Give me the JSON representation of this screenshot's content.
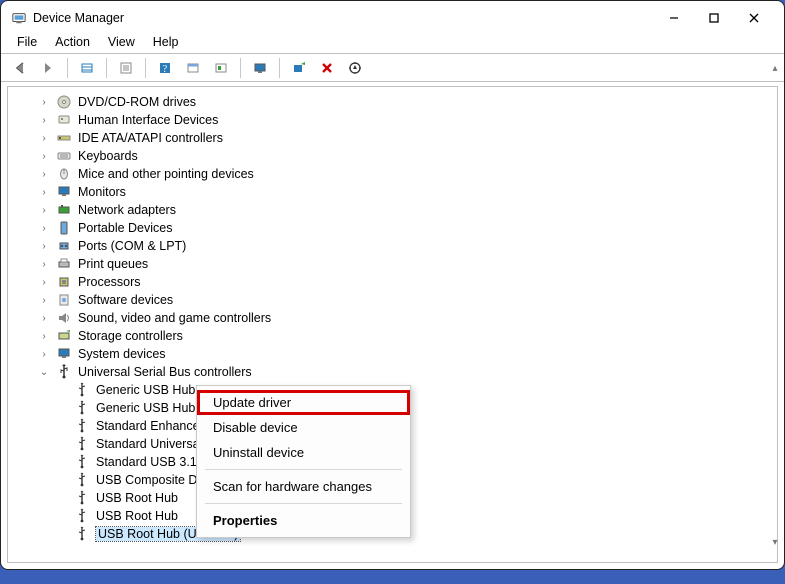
{
  "window": {
    "title": "Device Manager"
  },
  "menus": [
    "File",
    "Action",
    "View",
    "Help"
  ],
  "toolbar_icons": [
    "back-arrow-icon",
    "forward-arrow-icon",
    "divider",
    "show-hidden-icon",
    "divider",
    "properties-icon",
    "divider",
    "help-icon",
    "list-icon",
    "tree-icon",
    "divider",
    "monitor-icon",
    "divider",
    "scan-icon",
    "delete-red-x-icon",
    "target-icon"
  ],
  "tree": [
    {
      "label": "DVD/CD-ROM drives",
      "icon": "disc"
    },
    {
      "label": "Human Interface Devices",
      "icon": "hid"
    },
    {
      "label": "IDE ATA/ATAPI controllers",
      "icon": "ide"
    },
    {
      "label": "Keyboards",
      "icon": "keyboard"
    },
    {
      "label": "Mice and other pointing devices",
      "icon": "mouse"
    },
    {
      "label": "Monitors",
      "icon": "monitor"
    },
    {
      "label": "Network adapters",
      "icon": "network"
    },
    {
      "label": "Portable Devices",
      "icon": "portable"
    },
    {
      "label": "Ports (COM & LPT)",
      "icon": "port"
    },
    {
      "label": "Print queues",
      "icon": "printer"
    },
    {
      "label": "Processors",
      "icon": "cpu"
    },
    {
      "label": "Software devices",
      "icon": "software"
    },
    {
      "label": "Sound, video and game controllers",
      "icon": "sound"
    },
    {
      "label": "Storage controllers",
      "icon": "storage"
    },
    {
      "label": "System devices",
      "icon": "system"
    },
    {
      "label": "Universal Serial Bus controllers",
      "icon": "usb",
      "expanded": true,
      "children": [
        {
          "label": "Generic USB Hub"
        },
        {
          "label": "Generic USB Hub"
        },
        {
          "label": "Standard Enhance"
        },
        {
          "label": "Standard Universa"
        },
        {
          "label": "Standard USB 3.1 e"
        },
        {
          "label": "USB Composite De"
        },
        {
          "label": "USB Root Hub"
        },
        {
          "label": "USB Root Hub"
        },
        {
          "label": "USB Root Hub (USB 3.0)",
          "selected": true
        }
      ]
    }
  ],
  "context_menu": {
    "items": [
      {
        "label": "Update driver",
        "highlight": true
      },
      {
        "label": "Disable device"
      },
      {
        "label": "Uninstall device"
      },
      {
        "sep": true
      },
      {
        "label": "Scan for hardware changes"
      },
      {
        "sep": true
      },
      {
        "label": "Properties",
        "bold": true
      }
    ]
  }
}
